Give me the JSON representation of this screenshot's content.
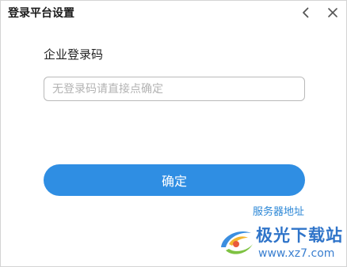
{
  "dialog": {
    "title": "登录平台设置",
    "back_icon": "chevron-left-icon",
    "close_icon": "close-icon"
  },
  "form": {
    "label": "企业登录码",
    "input_value": "",
    "input_placeholder": "无登录码请直接点确定",
    "confirm_label": "确定",
    "server_link": "服务器地址"
  },
  "watermark": {
    "logo_icon": "site-logo-icon",
    "name": "极光下载站",
    "url": "www.xz7.com"
  },
  "colors": {
    "accent": "#2f8ee3",
    "link": "#2a86d6",
    "input_border": "#b9b9b9",
    "watermark": "#2f74c9"
  }
}
